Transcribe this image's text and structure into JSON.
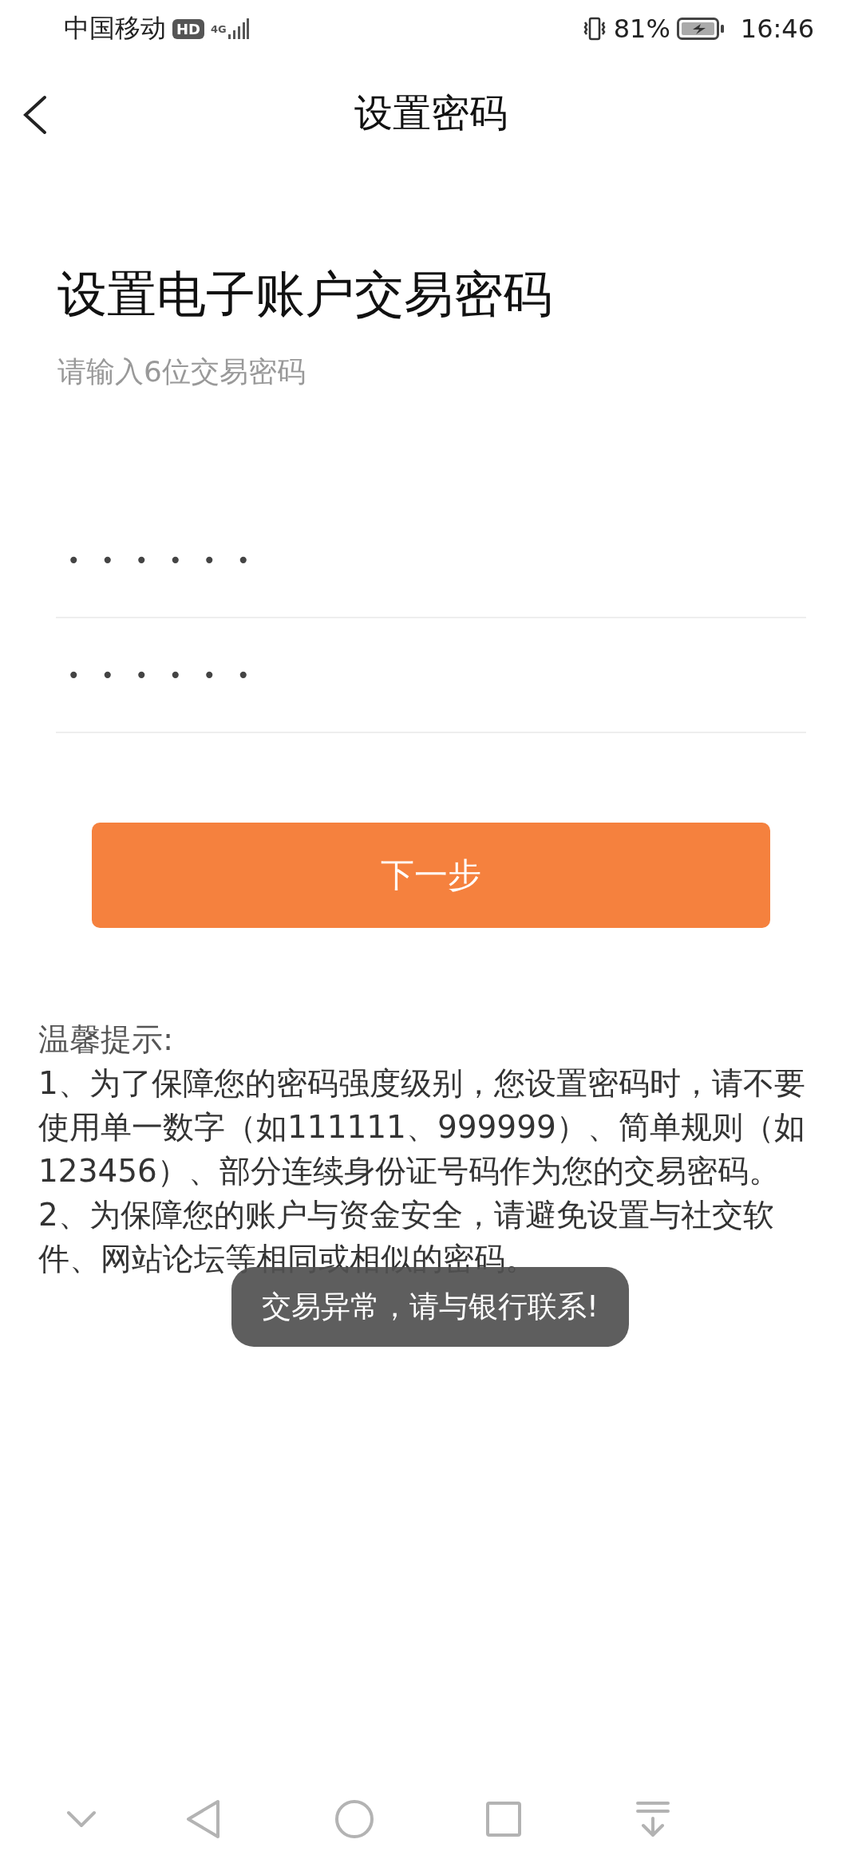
{
  "status_bar": {
    "carrier": "中国移动",
    "hd": "HD",
    "network": "4G",
    "battery": "81%",
    "time": "16:46"
  },
  "header": {
    "title": "设置密码"
  },
  "heading": "设置电子账户交易密码",
  "subtitle": "请输入6位交易密码",
  "password_fields": [
    {
      "value": "••••••"
    },
    {
      "value": "••••••"
    }
  ],
  "next_button": "下一步",
  "tips": [
    "温馨提示:",
    "1、为了保障您的密码强度级别，您设置密码时，请不要使用单一数字（如111111、999999）、简单规则（如123456）、部分连续身份证号码作为您的交易密码。",
    "2、为保障您的账户与资金安全，请避免设置与社交软件、网站论坛等相同或相似的密码。"
  ],
  "toast": "交易异常，请与银行联系!"
}
